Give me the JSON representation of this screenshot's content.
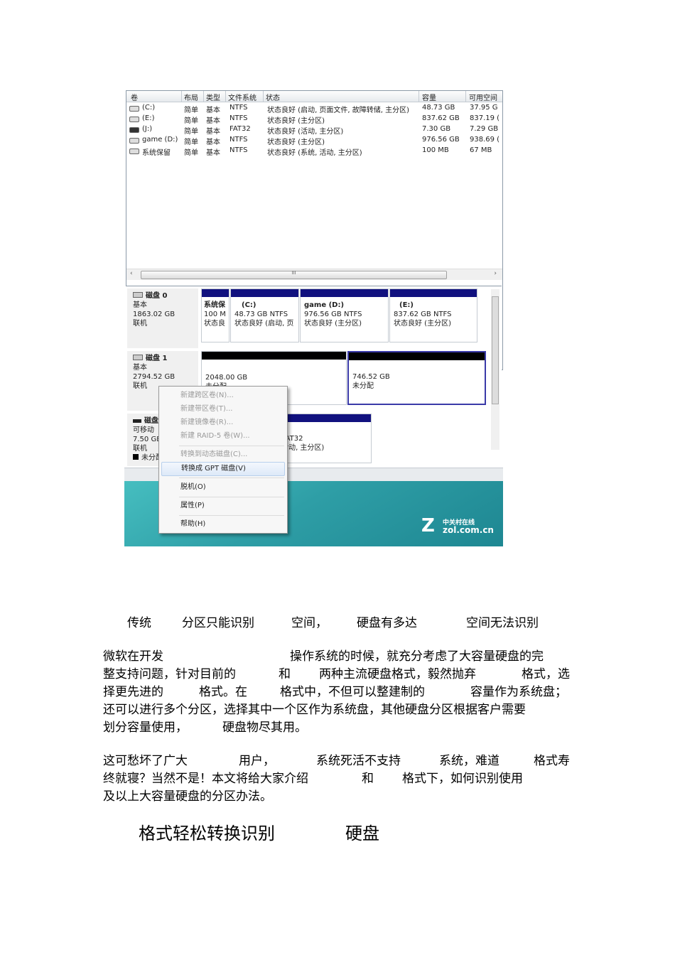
{
  "screenshot": {
    "volume_table": {
      "headers": [
        "卷",
        "布局",
        "类型",
        "文件系统",
        "状态",
        "容量",
        "可用空间"
      ],
      "rows": [
        {
          "name": "(C:)",
          "layout": "简单",
          "type": "基本",
          "fs": "NTFS",
          "status": "状态良好 (启动, 页面文件, 故障转储, 主分区)",
          "capacity": "48.73 GB",
          "free": "37.95 G"
        },
        {
          "name": "(E:)",
          "layout": "简单",
          "type": "基本",
          "fs": "NTFS",
          "status": "状态良好 (主分区)",
          "capacity": "837.62 GB",
          "free": "837.19 ("
        },
        {
          "name": "(J:)",
          "layout": "简单",
          "type": "基本",
          "fs": "FAT32",
          "status": "状态良好 (活动, 主分区)",
          "capacity": "7.30 GB",
          "free": "7.29 GB"
        },
        {
          "name": "game (D:)",
          "layout": "简单",
          "type": "基本",
          "fs": "NTFS",
          "status": "状态良好 (主分区)",
          "capacity": "976.56 GB",
          "free": "938.69 ("
        },
        {
          "name": "系统保留",
          "layout": "简单",
          "type": "基本",
          "fs": "NTFS",
          "status": "状态良好 (系统, 活动, 主分区)",
          "capacity": "100 MB",
          "free": "67 MB"
        }
      ],
      "scroll_arrow_left": "‹",
      "scroll_arrow_right": "›",
      "scroll_grip": "III"
    },
    "disks": {
      "disk0": {
        "name": "磁盘 0",
        "type": "基本",
        "size": "1863.02 GB",
        "state": "联机",
        "partitions": [
          {
            "l1": "系统保",
            "l2": "100 M",
            "l3": "状态良"
          },
          {
            "l1": "(C:)",
            "l2": "48.73 GB NTFS",
            "l3": "状态良好 (启动, 页"
          },
          {
            "l1": "game  (D:)",
            "l2": "976.56 GB NTFS",
            "l3": "状态良好 (主分区)"
          },
          {
            "l1": "(E:)",
            "l2": "837.62 GB NTFS",
            "l3": "状态良好 (主分区)"
          }
        ]
      },
      "disk1": {
        "name": "磁盘 1",
        "type": "基本",
        "size": "2794.52 GB",
        "state": "联机",
        "partitions": [
          {
            "l1": "2048.00 GB",
            "l2": "未分配"
          },
          {
            "l1": "746.52 GB",
            "l2": "未分配"
          }
        ]
      },
      "disk2": {
        "name": "磁盘",
        "type": "可移动",
        "size": "7.50 GB",
        "state": "联机",
        "legend": "未分配",
        "partition": {
          "l1": "GB FAT32",
          "l2": "好 (活动, 主分区)"
        }
      }
    },
    "context_menu": {
      "items": [
        "新建跨区卷(N)...",
        "新建带区卷(T)...",
        "新建镜像卷(R)...",
        "新建 RAID-5 卷(W)...",
        "转换到动态磁盘(C)...",
        "转换成 GPT 磁盘(V)",
        "脱机(O)",
        "属性(P)",
        "帮助(H)"
      ]
    },
    "watermark": {
      "z": "Z",
      "zh": "中关村在线",
      "en": "zol.com.cn"
    }
  },
  "document": {
    "caption": [
      "传统",
      "分区只能识别",
      "空间，",
      "硬盘有多达",
      "空间无法识别"
    ],
    "p1": [
      [
        "微软在开发",
        "操作系统的时候，就充分考虑了大容量硬盘的完"
      ],
      [
        "整支持问题，针对目前的",
        "和",
        "两种主流硬盘格式，毅然抛弃",
        "格式，选"
      ],
      [
        "择更先进的",
        "格式。在",
        "格式中，不但可以整建制的",
        "容量作为系统盘；"
      ],
      [
        "还可以进行多个分区，选择其中一个区作为系统盘，其他硬盘分区根据客户需要"
      ],
      [
        "划分容量使用，",
        "硬盘物尽其用。"
      ]
    ],
    "p2": [
      [
        "这可愁坏了广大",
        "用户，",
        "系统死活不支持",
        "系统，难道",
        "格式寿"
      ],
      [
        "终就寝？当然不是！本文将给大家介绍",
        "和",
        "格式下，如何识别使用"
      ],
      [
        "及以上大容量硬盘的分区办法。"
      ]
    ],
    "heading": [
      "格式轻松转换识别",
      "硬盘"
    ]
  }
}
